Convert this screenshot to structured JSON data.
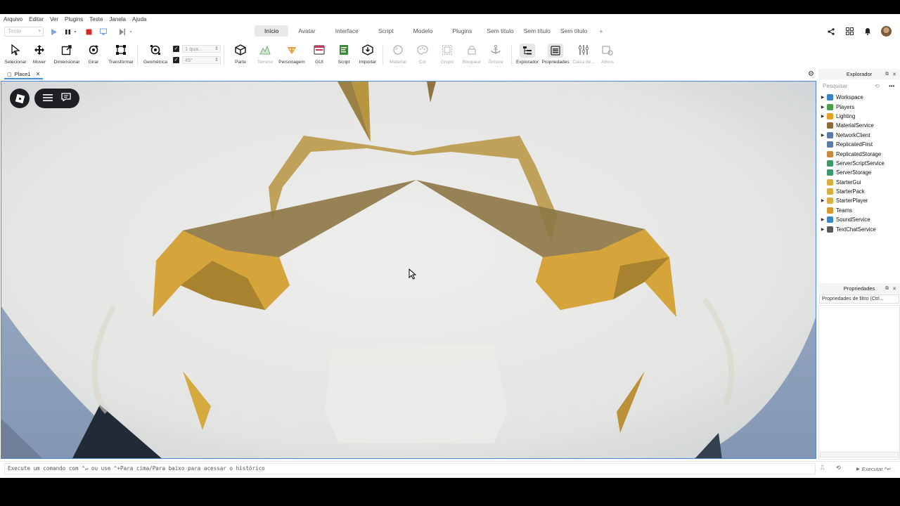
{
  "menubar": [
    "Arquivo",
    "Editar",
    "Ver",
    "Plugins",
    "Teste",
    "Janela",
    "Ajuda"
  ],
  "test_select": "Teste",
  "tabs": [
    {
      "label": "Início",
      "active": true
    },
    {
      "label": "Avatar"
    },
    {
      "label": "Interface"
    },
    {
      "label": "Script"
    },
    {
      "label": "Modelo"
    },
    {
      "label": "Plugins"
    },
    {
      "label": "Sem título"
    },
    {
      "label": "Sem título"
    },
    {
      "label": "Sem título"
    }
  ],
  "tab_add": "+",
  "ribbon": {
    "tools": [
      {
        "label": "Selecionar",
        "icon": "cursor-icon"
      },
      {
        "label": "Mover",
        "icon": "move-icon"
      },
      {
        "label": "Dimensionar",
        "icon": "scale-icon"
      },
      {
        "label": "Girar",
        "icon": "rotate-icon"
      },
      {
        "label": "Transformar",
        "icon": "transform-icon"
      },
      {
        "label": "Geométrica",
        "icon": "geometric-icon"
      },
      {
        "label": "Parte",
        "icon": "part-icon"
      },
      {
        "label": "Terreno",
        "icon": "terrain-icon"
      },
      {
        "label": "Personagem",
        "icon": "character-icon"
      },
      {
        "label": "GUI",
        "icon": "gui-icon"
      },
      {
        "label": "Script",
        "icon": "script-icon"
      },
      {
        "label": "Importar",
        "icon": "import-icon"
      },
      {
        "label": "Material",
        "icon": "material-icon"
      },
      {
        "label": "Cor",
        "icon": "color-icon"
      },
      {
        "label": "Grupo",
        "icon": "group-icon"
      },
      {
        "label": "Bloquear",
        "icon": "lock-icon"
      },
      {
        "label": "Âncora",
        "icon": "anchor-icon"
      },
      {
        "label": "Explorador",
        "icon": "explorer-icon"
      },
      {
        "label": "Propriedades",
        "icon": "properties-icon"
      },
      {
        "label": "Caixa de...",
        "icon": "toolbox-icon"
      },
      {
        "label": "Ativos",
        "icon": "assets-icon"
      }
    ],
    "snap_move": "1 qua...",
    "snap_rotate": "45°"
  },
  "doc_tab": "Place1",
  "command_bar": {
    "placeholder": "Execute um comando com ^↵ ou use ^+Para cima/Para baixo para acessar o histórico",
    "execute_label": "Executar ^↵"
  },
  "explorer": {
    "title": "Explorador",
    "search_placeholder": "Pesquisar",
    "items": [
      {
        "label": "Workspace",
        "expandable": true,
        "color": "#3b82c4"
      },
      {
        "label": "Players",
        "expandable": true,
        "color": "#4aa04a"
      },
      {
        "label": "Lighting",
        "expandable": true,
        "color": "#e0a020"
      },
      {
        "label": "MaterialService",
        "expandable": false,
        "color": "#8a6a3a"
      },
      {
        "label": "NetworkClient",
        "expandable": true,
        "color": "#5a7aa8"
      },
      {
        "label": "ReplicatedFirst",
        "expandable": false,
        "color": "#5a7aa8"
      },
      {
        "label": "ReplicatedStorage",
        "expandable": false,
        "color": "#c98a3a"
      },
      {
        "label": "ServerScriptService",
        "expandable": false,
        "color": "#3a9a6a"
      },
      {
        "label": "ServerStorage",
        "expandable": false,
        "color": "#3a9a6a"
      },
      {
        "label": "StarterGui",
        "expandable": false,
        "color": "#d8b040"
      },
      {
        "label": "StarterPack",
        "expandable": false,
        "color": "#d8b040"
      },
      {
        "label": "StarterPlayer",
        "expandable": true,
        "color": "#d8b040"
      },
      {
        "label": "Teams",
        "expandable": false,
        "color": "#d89a30"
      },
      {
        "label": "SoundService",
        "expandable": true,
        "color": "#3a8ac8"
      },
      {
        "label": "TextChatService",
        "expandable": true,
        "color": "#5a5a5a"
      }
    ]
  },
  "properties": {
    "title": "Propriedades",
    "filter_placeholder": "Propriedades de filtro (Ctrl..."
  }
}
